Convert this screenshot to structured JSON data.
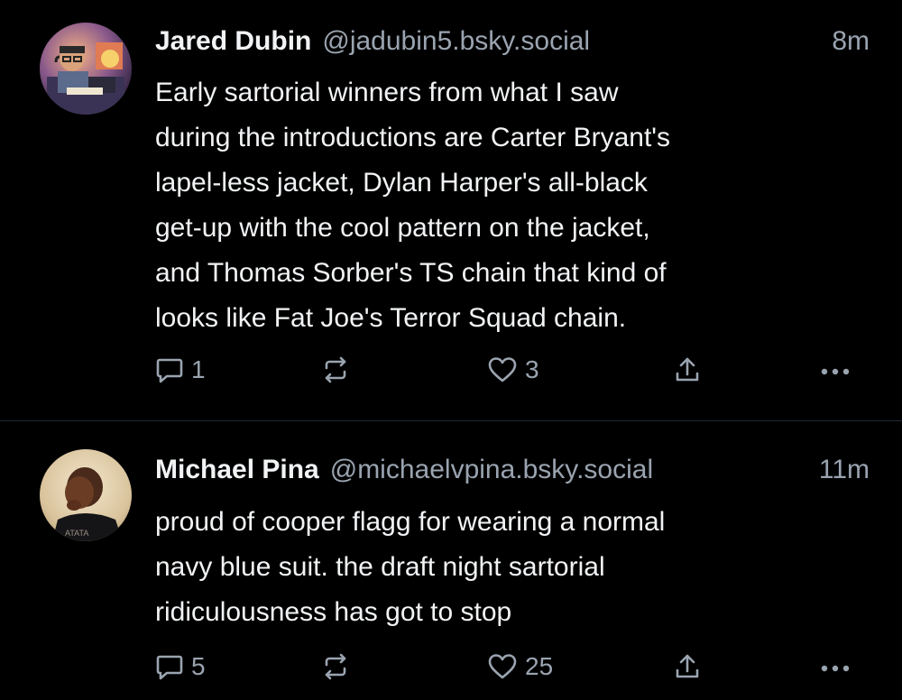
{
  "posts": [
    {
      "author": {
        "display_name": "Jared Dubin",
        "handle": "@jadubin5.bsky.social"
      },
      "timestamp": "8m",
      "text_lines": [
        "Early sartorial winners from what I saw",
        "during the introductions are Carter Bryant's",
        "lapel-less jacket, Dylan Harper's all-black",
        "get-up with the cool pattern on the jacket,",
        "and Thomas Sorber's TS chain that kind of",
        "looks like Fat Joe's Terror Squad chain."
      ],
      "actions": {
        "reply_icon": "reply-bubble-icon",
        "reply_count": "1",
        "repost_icon": "repost-icon",
        "like_icon": "heart-icon",
        "like_count": "3",
        "share_icon": "share-icon",
        "more_icon": "more-dots-icon"
      }
    },
    {
      "author": {
        "display_name": "Michael Pina",
        "handle": "@michaelvpina.bsky.social"
      },
      "timestamp": "11m",
      "text_lines": [
        "proud of cooper flagg for wearing a normal",
        "navy blue suit. the draft night sartorial",
        "ridiculousness has got to stop"
      ],
      "actions": {
        "reply_icon": "reply-bubble-icon",
        "reply_count": "5",
        "repost_icon": "repost-icon",
        "like_icon": "heart-icon",
        "like_count": "25",
        "share_icon": "share-icon",
        "more_icon": "more-dots-icon"
      }
    }
  ],
  "colors": {
    "background": "#000000",
    "primary_text": "#f1f3f5",
    "secondary_text": "#9aa4b0",
    "divider": "#1f2937"
  }
}
